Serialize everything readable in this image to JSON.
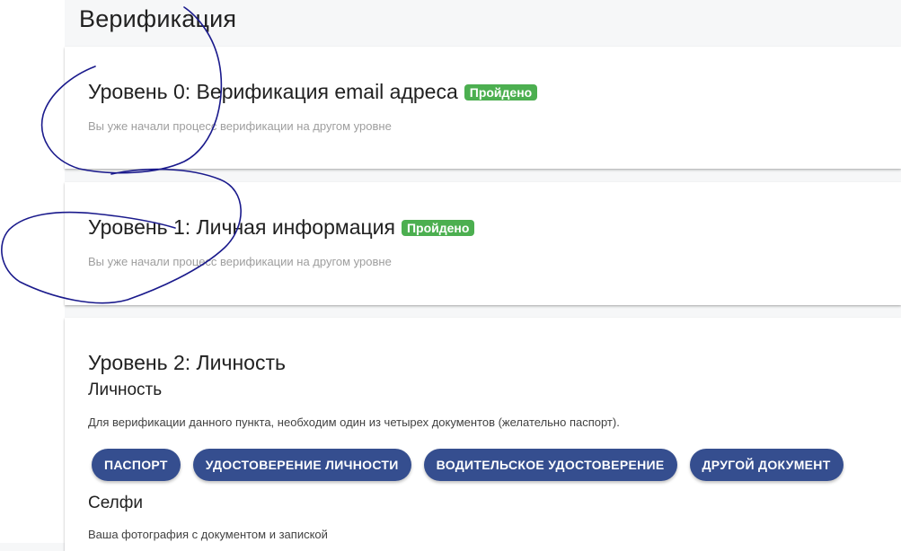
{
  "page": {
    "title": "Верификация"
  },
  "levels": [
    {
      "title": "Уровень 0: Верификация email адреса",
      "badge": "Пройдено",
      "note": "Вы уже начали процесс верификации на другом уровне"
    },
    {
      "title": "Уровень 1: Личная информация",
      "badge": "Пройдено",
      "note": "Вы уже начали процесс верификации на другом уровне"
    },
    {
      "title": "Уровень 2: Личность",
      "identity": {
        "title": "Личность",
        "description": "Для верификации данного пункта, необходим один из четырех документов (желательно паспорт).",
        "buttons": [
          "ПАСПОРТ",
          "УДОСТОВЕРЕНИЕ ЛИЧНОСТИ",
          "ВОДИТЕЛЬСКОЕ УДОСТОВЕРЕНИЕ",
          "ДРУГОЙ ДОКУМЕНТ"
        ]
      },
      "selfie": {
        "title": "Селфи",
        "description": "Ваша фотография с документом и запиской"
      }
    }
  ],
  "colors": {
    "badge": "#4caf50",
    "button": "#354e8f",
    "scribble": "#1a1a8c"
  }
}
